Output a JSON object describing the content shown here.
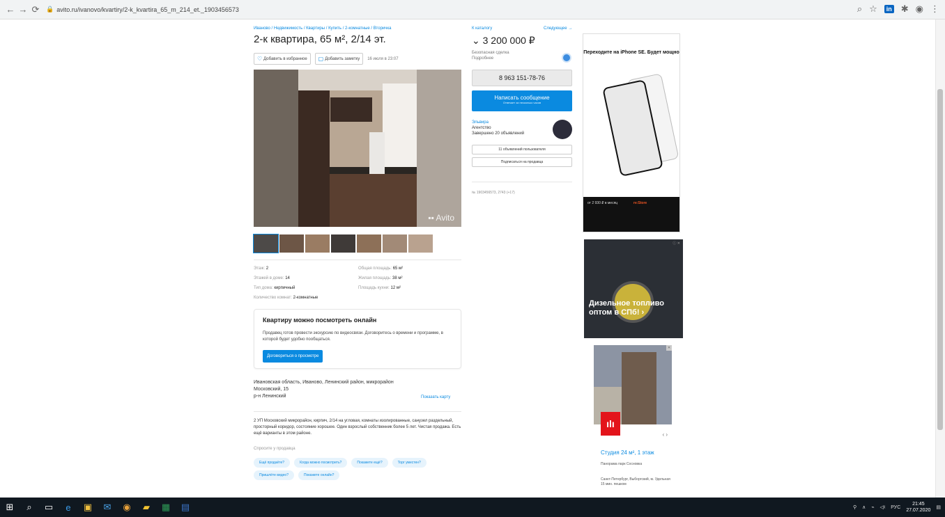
{
  "browser": {
    "url": "avito.ru/ivanovo/kvartiry/2-k_kvartira_65_m_214_et._1903456573"
  },
  "listing": {
    "breadcrumb": "Иваново / Недвижимость / Квартиры / Купить / 2-комнатные / Вторичка",
    "title": "2-к квартира, 65 м², 2/14 эт.",
    "add_favorite": "Добавить в избранное",
    "add_note": "Добавить заметку",
    "date": "16 июля в 23:07",
    "watermark": "Avito",
    "params": {
      "floor_label": "Этаж:",
      "floor": "2",
      "floors_label": "Этажей в доме:",
      "floors": "14",
      "house_label": "Тип дома:",
      "house": "кирпичный",
      "rooms_label": "Количество комнат:",
      "rooms": "2-комнатные",
      "total_label": "Общая площадь:",
      "total": "65 м²",
      "living_label": "Жилая площадь:",
      "living": "38 м²",
      "kitchen_label": "Площадь кухни:",
      "kitchen": "12 м²"
    },
    "online": {
      "title": "Квартиру можно посмотреть онлайн",
      "text": "Продавец готов провести экскурсию по видеосвязи. Договоритесь о времени и программе, в которой будет удобно пообщаться.",
      "button": "Договориться о просмотре"
    },
    "address": {
      "line1": "Ивановская область, Иваново, Ленинский район, микрорайон",
      "line2": "Московский, 15",
      "line3": "р-н Ленинский",
      "map_link": "Показать карту"
    },
    "description": "2 УП Московский микрорайон, кирпич, 2/14 на угловая, комнаты изолированные, санузел раздельный, просторный коридор, состояние хорошее. Один взрослый собственник более 5 лет. Чистая продажа. Есть ещё варианты в этом районе.",
    "ask_label": "Спросите у продавца",
    "chips": [
      "Ещё продаёте?",
      "Когда можно посмотреть?",
      "Покажете ещё?",
      "Торг уместен?",
      "Пришлёте видео?",
      "Покажете онлайн?"
    ]
  },
  "sidebar": {
    "back": "К каталогу",
    "next": "Следующее →",
    "price": "3 200 000 ₽",
    "price_sub1": "Безопасная сделка",
    "price_sub2": "Подробнее",
    "phone": "8 963 151-78-76",
    "write_l1": "Написать сообщение",
    "write_l2": "Отвечает за несколько часов",
    "seller_name": "Эльвира",
    "seller_type": "Агентство",
    "seller_done": "Завершено 20 объявлений",
    "btn_all": "11 объявлений пользователя",
    "btn_sub": "Подписаться на продавца",
    "meta": "№ 1903456573,  2743 (+17)"
  },
  "ads": {
    "ad1_title": "Переходите на iPhone SE. Будет мощно.",
    "ad1_price": "от 2 930 ₽ в месяц",
    "ad1_brand": "re:Store",
    "ad2_text": "Дизельное топливо оптом в СПб! ›",
    "ad3_title": "Студия 24 м², 1 этаж",
    "ad3_sub": "Панорама парк Сосновка",
    "ad3_addr": "Санкт-Петербург, Выборгский, м. Удельная 15 мин. пешком"
  },
  "taskbar": {
    "lang": "РУС",
    "time": "21:45",
    "date": "27.07.2020"
  }
}
